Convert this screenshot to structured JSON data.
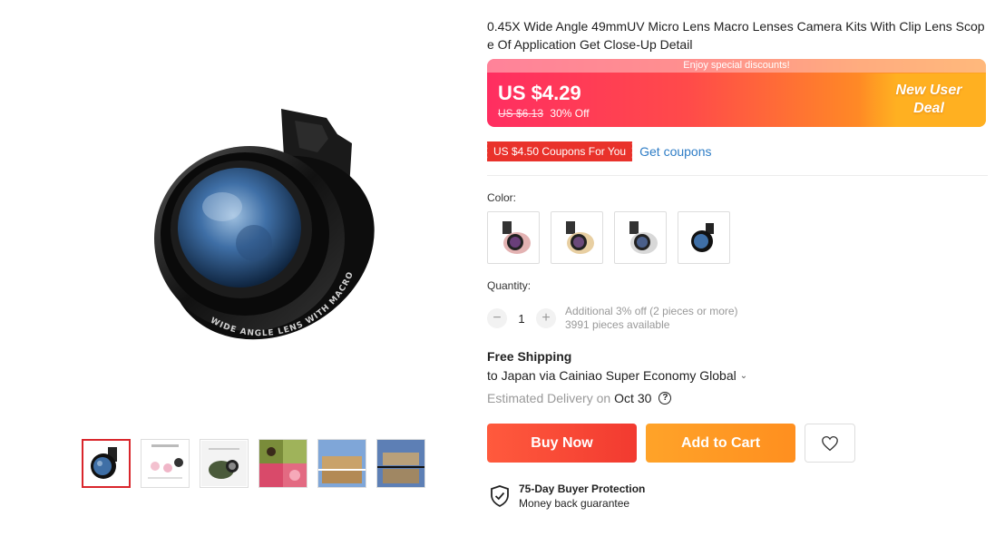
{
  "product": {
    "title": "0.45X Wide Angle 49mmUV Micro Lens Macro Lenses Camera Kits With Clip Lens Scope Of Application Get Close-Up Detail",
    "lens_text": "WIDE ANGLE LENS WITH MACRO"
  },
  "price": {
    "banner_text": "Enjoy special discounts!",
    "current": "US $4.29",
    "original": "US $6.13",
    "discount": "30% Off",
    "deal_line1": "New User",
    "deal_line2": "Deal"
  },
  "coupon": {
    "tag": "US $4.50 Coupons For You",
    "link": "Get coupons"
  },
  "color": {
    "label": "Color:",
    "options": [
      "rose-gold",
      "gold",
      "silver",
      "black"
    ]
  },
  "quantity": {
    "label": "Quantity:",
    "value": "1",
    "minus": "−",
    "plus": "+",
    "info_line1": "Additional 3% off (2 pieces or more)",
    "info_line2": "3991 pieces available"
  },
  "shipping": {
    "title": "Free Shipping",
    "route": "to Japan via Cainiao Super Economy Global",
    "estimated_label": "Estimated Delivery on",
    "estimated_date": "Oct 30",
    "help": "?"
  },
  "actions": {
    "buy_now": "Buy Now",
    "add_to_cart": "Add to Cart"
  },
  "protection": {
    "title": "75-Day Buyer Protection",
    "subtitle": "Money back guarantee"
  },
  "gallery": {
    "thumbnails": [
      "lens-black",
      "infographic",
      "clip-on-phone",
      "macro-flowers",
      "buildings-wide",
      "castle-wide"
    ]
  },
  "icons": {
    "chevron": "chevron-down-icon",
    "heart": "heart-icon",
    "shield": "shield-check-icon"
  },
  "colors": {
    "accent_red": "#e9322b",
    "buy_now": "#f23a30",
    "add_to_cart": "#ff9a25",
    "link_blue": "#2e7dc6"
  }
}
